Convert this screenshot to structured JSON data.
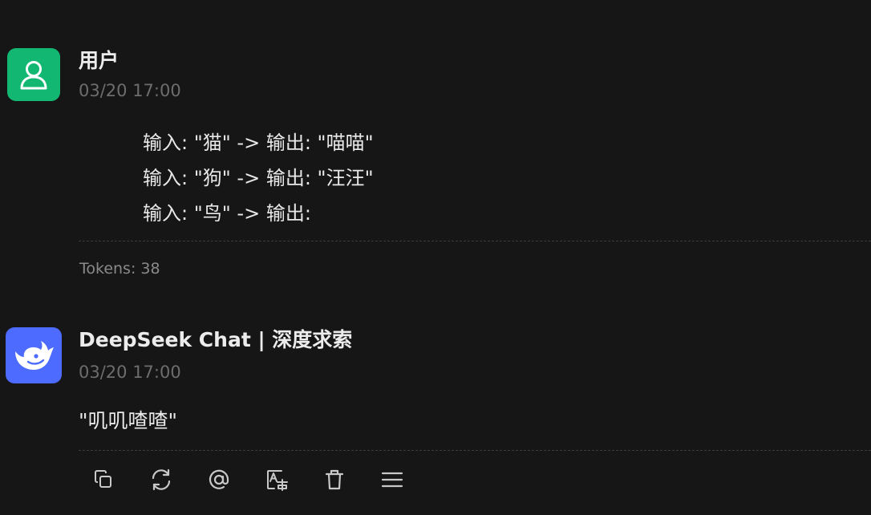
{
  "user_message": {
    "author": "用户",
    "timestamp": "03/20 17:00",
    "lines": [
      "输入: \"猫\" -> 输出: \"喵喵\"",
      "输入: \"狗\" -> 输出: \"汪汪\"",
      "输入: \"鸟\" -> 输出:"
    ],
    "tokens": "Tokens: 38",
    "avatar_icon": "user-icon",
    "avatar_color": "#12b772"
  },
  "assistant_message": {
    "author": "DeepSeek Chat | 深度求索",
    "timestamp": "03/20 17:00",
    "content": "\"叽叽喳喳\"",
    "avatar_icon": "deepseek-whale-icon",
    "avatar_color": "#4d6bfe"
  },
  "toolbar": {
    "icons": [
      "copy-icon",
      "regenerate-icon",
      "mention-icon",
      "translate-icon",
      "delete-icon",
      "menu-icon"
    ]
  }
}
